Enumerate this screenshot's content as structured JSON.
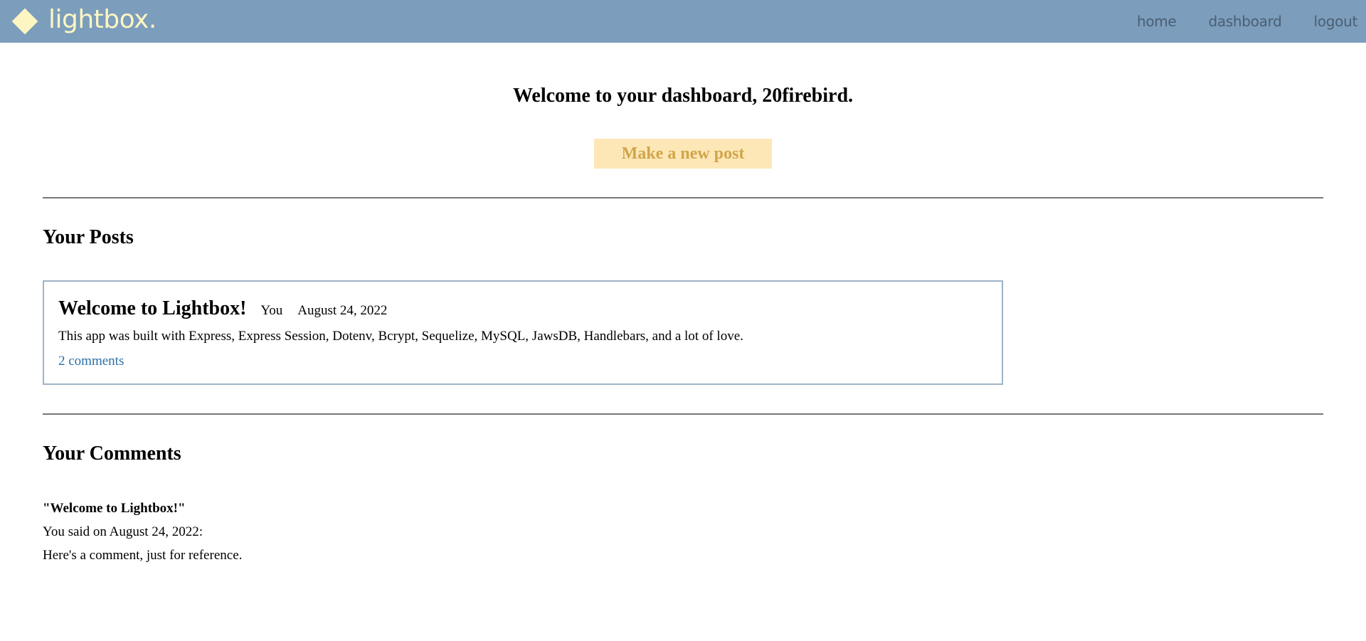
{
  "header": {
    "brand": "lightbox.",
    "nav": {
      "home": "home",
      "dashboard": "dashboard",
      "logout": "logout"
    }
  },
  "main": {
    "welcome": "Welcome to your dashboard, 20firebird.",
    "new_post_label": "Make a new post",
    "posts_heading": "Your Posts",
    "posts": [
      {
        "title": "Welcome to Lightbox!",
        "author": "You",
        "date": "August 24, 2022",
        "body": "This app was built with Express, Express Session, Dotenv, Bcrypt, Sequelize, MySQL, JawsDB, Handlebars, and a lot of love.",
        "comments_link": "2 comments"
      }
    ],
    "comments_heading": "Your Comments",
    "comments": [
      {
        "post_title": "\"Welcome to Lightbox!\"",
        "meta": "You said on August 24, 2022:",
        "text": "Here's a comment, just for reference."
      }
    ]
  },
  "colors": {
    "header_bg": "#7c9dbc",
    "brand": "#fdf6c3",
    "nav_link": "#4a5f74",
    "button_bg": "#fde7b6",
    "button_text": "#d1a54b",
    "link": "#2a6fa8",
    "card_border": "#9fb3c8"
  },
  "icons": {
    "brand_mark": "diamond-icon"
  }
}
